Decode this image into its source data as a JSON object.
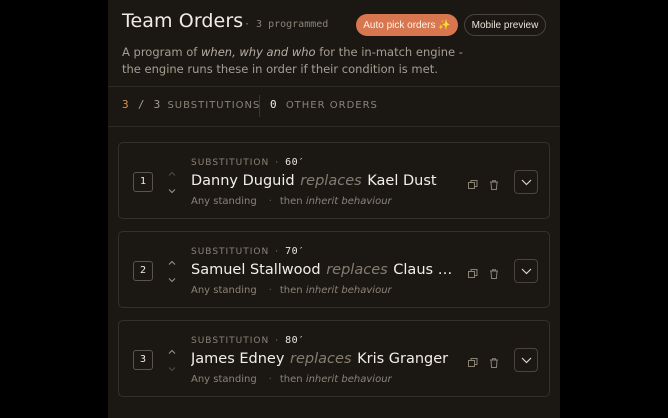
{
  "header": {
    "title": "Team Orders",
    "separator": "·",
    "count": "3 programmed",
    "auto_button": "Auto pick orders ✨",
    "mobile_button": "Mobile preview",
    "description": {
      "prefix": "A program of ",
      "emphasis": "when, why and who",
      "suffix": " for the in-match engine - the engine runs these in order if their condition is met."
    }
  },
  "stats": {
    "subs_used": "3",
    "slash": "/",
    "subs_total": "3",
    "subs_label": "SUBSTITUTIONS",
    "other_count": "0",
    "other_label": "OTHER ORDERS"
  },
  "orders": [
    {
      "index": "1",
      "kind": "SUBSTITUTION",
      "sep": "·",
      "minute": "60′",
      "player_in": "Danny Duguid",
      "replaces": "replaces",
      "player_out": "Kael Dust",
      "condition": "Any standing",
      "dot": "·",
      "then": "then",
      "behaviour": "inherit behaviour"
    },
    {
      "index": "2",
      "kind": "SUBSTITUTION",
      "sep": "·",
      "minute": "70′",
      "player_in": "Samuel Stallwood",
      "replaces": "replaces",
      "player_out": "Claus Bail…",
      "condition": "Any standing",
      "dot": "·",
      "then": "then",
      "behaviour": "inherit behaviour"
    },
    {
      "index": "3",
      "kind": "SUBSTITUTION",
      "sep": "·",
      "minute": "80′",
      "player_in": "James Edney",
      "replaces": "replaces",
      "player_out": "Kris Granger",
      "condition": "Any standing",
      "dot": "·",
      "then": "then",
      "behaviour": "inherit behaviour"
    }
  ],
  "icons": {
    "up": "chevron-up-icon",
    "down": "chevron-down-icon",
    "copy": "copy-icon",
    "trash": "trash-icon",
    "expand": "chevron-down-icon"
  },
  "colors": {
    "accent": "#d8764f",
    "stat_accent": "#d8924f",
    "panel": "#1b1814",
    "background": "#000000"
  }
}
